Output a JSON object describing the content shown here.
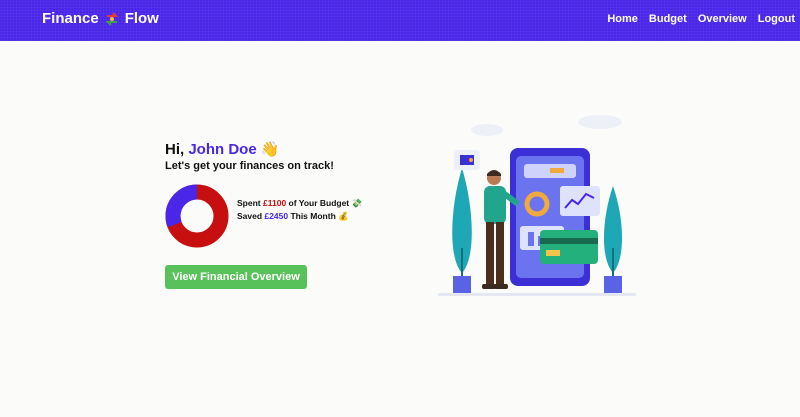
{
  "nav": {
    "brand_left": "Finance",
    "brand_right": "Flow",
    "links": [
      "Home",
      "Budget",
      "Overview",
      "Logout"
    ]
  },
  "hero": {
    "greeting_prefix": "Hi,",
    "user_name": "John Doe",
    "greeting_emoji": "👋",
    "subtitle": "Let's get your finances on track!",
    "spent_prefix": "Spent",
    "spent_amount": "£1100",
    "spent_suffix": "of Your Budget 💸",
    "saved_prefix": "Saved",
    "saved_amount": "£2450",
    "saved_suffix": "This Month 💰",
    "cta_label": "View Financial Overview"
  },
  "donut": {
    "spent_fraction": 0.31,
    "colors": {
      "spent": "#4a26e8",
      "remaining": "#c80f0f"
    }
  },
  "colors": {
    "brand": "#4a26e8",
    "spent": "#c80f0f",
    "saved": "#4a26e8",
    "cta": "#58c15a"
  },
  "icons": [
    "money-exchange-icon",
    "waving-hand-icon",
    "money-wings-icon",
    "money-bag-icon"
  ]
}
